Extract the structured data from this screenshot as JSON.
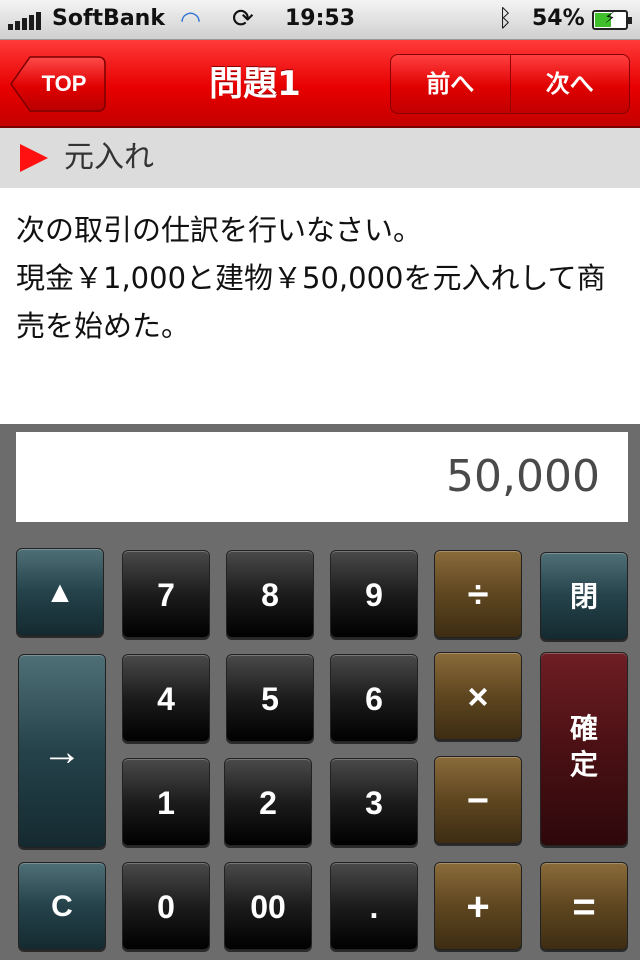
{
  "status": {
    "carrier": "SoftBank",
    "time": "19:53",
    "battery_pct": "54%",
    "battery_level": 0.54,
    "icons": [
      "signal-icon",
      "wifi-icon",
      "sync-icon",
      "bluetooth-icon",
      "battery-icon"
    ]
  },
  "nav": {
    "back_label": "TOP",
    "title": "問題1",
    "prev_label": "前へ",
    "next_label": "次へ"
  },
  "section": {
    "title": "元入れ"
  },
  "question": {
    "line1": "次の取引の仕訳を行いなさい。",
    "line2": "現金￥1,000と建物￥50,000を元入れして商売を始めた。"
  },
  "calculator": {
    "display": "50,000",
    "keys": {
      "up": "▲",
      "seven": "7",
      "eight": "8",
      "nine": "9",
      "divide": "÷",
      "close": "閉",
      "four": "4",
      "five": "5",
      "six": "6",
      "multiply": "×",
      "arrow": "→",
      "confirm": "確定",
      "one": "1",
      "two": "2",
      "three": "3",
      "minus": "−",
      "clear": "C",
      "zero": "0",
      "double_zero": "00",
      "dot": ".",
      "plus": "+",
      "equals": "="
    }
  },
  "colors": {
    "nav_red": "#e80000",
    "accent_triangle": "#ff1111",
    "key_teal": "#25424a",
    "key_brown": "#5e4620",
    "key_red": "#4a1014"
  }
}
